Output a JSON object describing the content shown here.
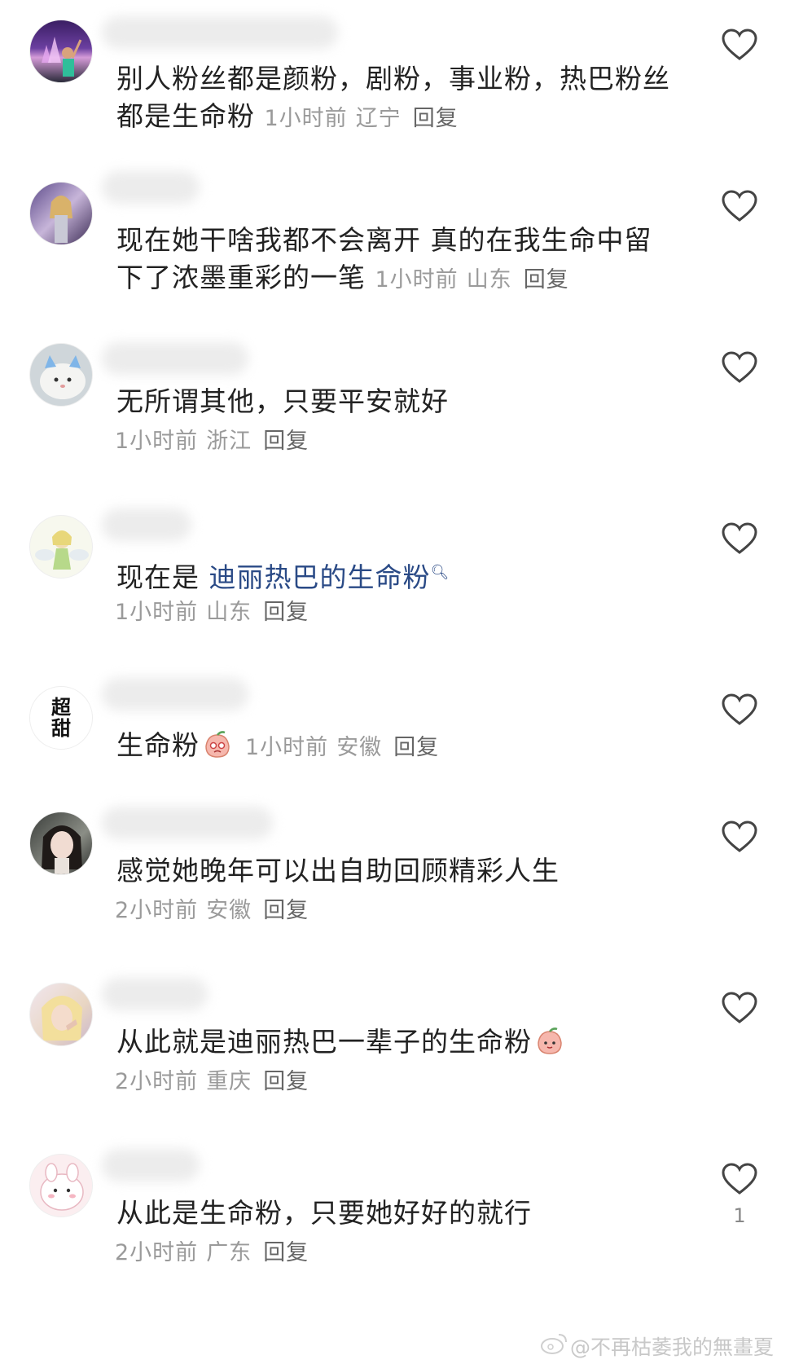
{
  "comments": [
    {
      "text": "别人粉丝都是颜粉，剧粉，事业粉，热巴粉丝都是生命粉",
      "time": "1小时前",
      "location": "辽宁",
      "reply": "回复"
    },
    {
      "text": "现在她干啥我都不会离开 真的在我生命中留下了浓墨重彩的一笔",
      "time": "1小时前",
      "location": "山东",
      "reply": "回复"
    },
    {
      "text": "无所谓其他，只要平安就好",
      "time": "1小时前",
      "location": "浙江",
      "reply": "回复"
    },
    {
      "text_prefix": "现在是 ",
      "text_link": "迪丽热巴的生命粉",
      "time": "1小时前",
      "location": "山东",
      "reply": "回复"
    },
    {
      "text": "生命粉",
      "time": "1小时前",
      "location": "安徽",
      "reply": "回复",
      "avatar_text": [
        "超",
        "甜"
      ]
    },
    {
      "text": "感觉她晚年可以出自助回顾精彩人生",
      "time": "2小时前",
      "location": "安徽",
      "reply": "回复"
    },
    {
      "text": "从此就是迪丽热巴一辈子的生命粉",
      "time": "2小时前",
      "location": "重庆",
      "reply": "回复"
    },
    {
      "text": "从此是生命粉，只要她好好的就行",
      "time": "2小时前",
      "location": "广东",
      "reply": "回复",
      "likes": "1"
    }
  ],
  "watermark": "@不再枯萎我的無畫夏",
  "colors": {
    "link": "#2a4a86",
    "meta": "#9a9a9a",
    "text": "#222222"
  }
}
